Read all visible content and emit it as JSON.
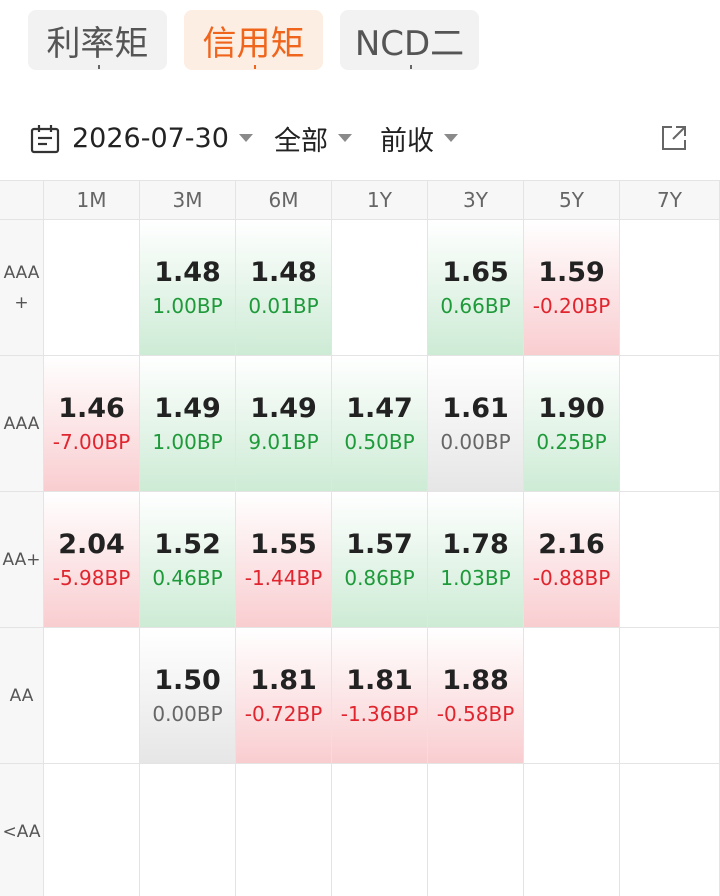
{
  "tabs": [
    {
      "label": "利率矩",
      "active": false
    },
    {
      "label": "信用矩",
      "active": true
    },
    {
      "label": "NCD二",
      "active": false
    }
  ],
  "filters": {
    "calendar_icon": "calendar-icon",
    "date": "2026-07-30",
    "scope": "全部",
    "compare": "前收",
    "share_icon": "share-icon"
  },
  "colors": {
    "accent": "#f0651c",
    "up_text": "#1e9a3a",
    "down_text": "#e0252f",
    "flat_text": "#666666"
  },
  "matrix": {
    "columns": [
      "1M",
      "3M",
      "6M",
      "1Y",
      "3Y",
      "5Y",
      "7Y"
    ],
    "rows": [
      {
        "label": "AAA\n+",
        "cells": [
          null,
          {
            "value": "1.48",
            "change": "1.00BP",
            "trend": "green"
          },
          {
            "value": "1.48",
            "change": "0.01BP",
            "trend": "green"
          },
          null,
          {
            "value": "1.65",
            "change": "0.66BP",
            "trend": "green"
          },
          {
            "value": "1.59",
            "change": "-0.20BP",
            "trend": "red"
          },
          null
        ]
      },
      {
        "label": "AAA",
        "cells": [
          {
            "value": "1.46",
            "change": "-7.00BP",
            "trend": "red"
          },
          {
            "value": "1.49",
            "change": "1.00BP",
            "trend": "green"
          },
          {
            "value": "1.49",
            "change": "9.01BP",
            "trend": "green"
          },
          {
            "value": "1.47",
            "change": "0.50BP",
            "trend": "green"
          },
          {
            "value": "1.61",
            "change": "0.00BP",
            "trend": "gray"
          },
          {
            "value": "1.90",
            "change": "0.25BP",
            "trend": "green"
          },
          null
        ]
      },
      {
        "label": "AA+",
        "cells": [
          {
            "value": "2.04",
            "change": "-5.98BP",
            "trend": "red"
          },
          {
            "value": "1.52",
            "change": "0.46BP",
            "trend": "green"
          },
          {
            "value": "1.55",
            "change": "-1.44BP",
            "trend": "red"
          },
          {
            "value": "1.57",
            "change": "0.86BP",
            "trend": "green"
          },
          {
            "value": "1.78",
            "change": "1.03BP",
            "trend": "green"
          },
          {
            "value": "2.16",
            "change": "-0.88BP",
            "trend": "red"
          },
          null
        ]
      },
      {
        "label": "AA",
        "cells": [
          null,
          {
            "value": "1.50",
            "change": "0.00BP",
            "trend": "gray"
          },
          {
            "value": "1.81",
            "change": "-0.72BP",
            "trend": "red"
          },
          {
            "value": "1.81",
            "change": "-1.36BP",
            "trend": "red"
          },
          {
            "value": "1.88",
            "change": "-0.58BP",
            "trend": "red"
          },
          null,
          null
        ]
      },
      {
        "label": "<AA",
        "cells": [
          null,
          null,
          null,
          null,
          null,
          null,
          null
        ]
      }
    ]
  }
}
